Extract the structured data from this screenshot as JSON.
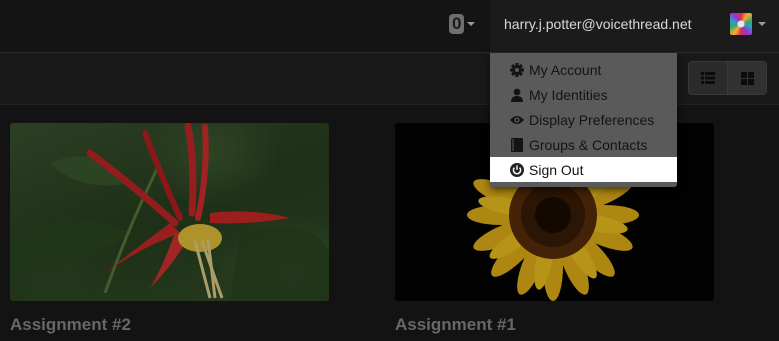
{
  "header": {
    "notification_count": "0",
    "user_email": "harry.j.potter@voicethread.net"
  },
  "toolbar": {
    "list_view_icon": "list-icon",
    "grid_view_icon": "grid-icon"
  },
  "user_menu": {
    "items": [
      {
        "label": "My Account",
        "icon": "gear-icon"
      },
      {
        "label": "My Identities",
        "icon": "person-icon"
      },
      {
        "label": "Display Preferences",
        "icon": "eye-icon"
      },
      {
        "label": "Groups & Contacts",
        "icon": "address-book-icon"
      },
      {
        "label": "Sign Out",
        "icon": "power-icon",
        "highlighted": true
      }
    ]
  },
  "threads": [
    {
      "title": "Assignment #2",
      "thumbnail": "red columbine flower"
    },
    {
      "title": "Assignment #1",
      "thumbnail": "sunflower"
    }
  ],
  "colors": {
    "menu_background": "#5a5a5a",
    "menu_highlight": "#ffffff",
    "page_background": "#1a1a1a"
  }
}
